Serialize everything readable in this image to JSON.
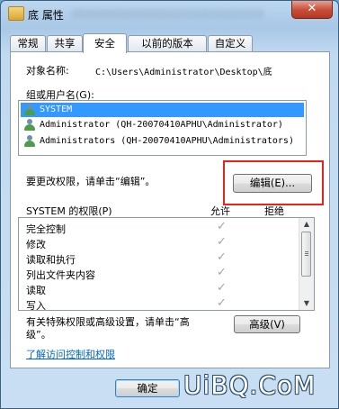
{
  "window": {
    "title": "底 属性",
    "close_glyph": "✕",
    "icon": "folder-icon"
  },
  "tabs": [
    {
      "label": "常规"
    },
    {
      "label": "共享"
    },
    {
      "label": "安全"
    },
    {
      "label": "以前的版本"
    },
    {
      "label": "自定义"
    }
  ],
  "security": {
    "object_name_label": "对象名称:",
    "object_name_value": "C:\\Users\\Administrator\\Desktop\\底",
    "group_label": "组或用户名(G):",
    "users": [
      {
        "name": "SYSTEM",
        "selected": true
      },
      {
        "name": "Administrator (QH-20070410APHU\\Administrator)",
        "selected": false
      },
      {
        "name": "Administrators (QH-20070410APHU\\Administrators)",
        "selected": false
      }
    ],
    "change_hint": "要更改权限，请单击“编辑”。",
    "edit_button": "编辑(E)...",
    "permissions_label": "SYSTEM 的权限(P)",
    "allow_header": "允许",
    "deny_header": "拒绝",
    "permissions": [
      {
        "name": "完全控制",
        "allow": "✓"
      },
      {
        "name": "修改",
        "allow": "✓"
      },
      {
        "name": "读取和执行",
        "allow": "✓"
      },
      {
        "name": "列出文件夹内容",
        "allow": "✓"
      },
      {
        "name": "读取",
        "allow": "✓"
      },
      {
        "name": "写入",
        "allow": "✓"
      }
    ],
    "advanced_hint_line1": "有关特殊权限或高级设置，请单击“高",
    "advanced_hint_line2": "级”。",
    "advanced_button": "高级(V)",
    "learn_link": "了解访问控制和权限"
  },
  "footer": {
    "ok_button": "确定"
  },
  "watermark": "UiBQ.CoM",
  "colors": {
    "selection": "#3399ff",
    "highlight_box": "#e8231c",
    "link": "#0066cc",
    "close_button": "#c9513c"
  }
}
